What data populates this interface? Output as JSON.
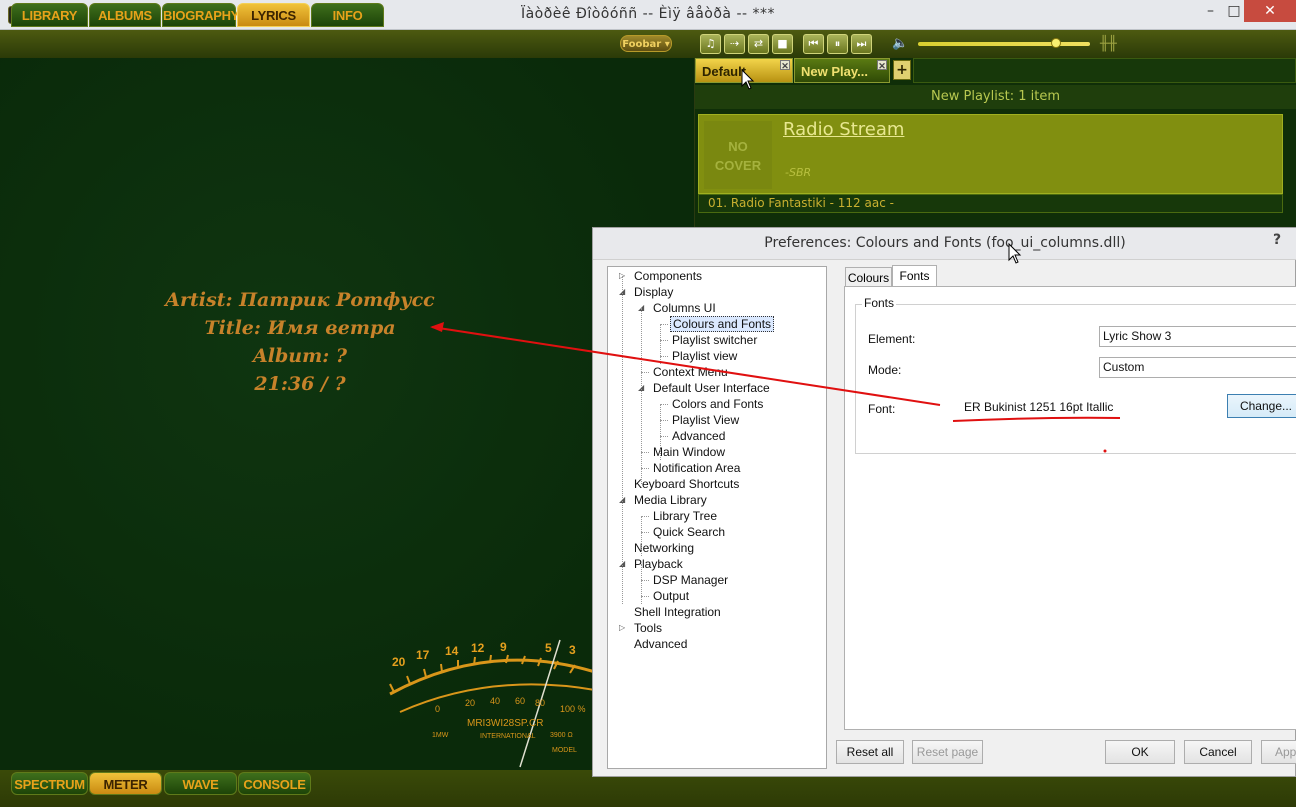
{
  "window": {
    "title": "Ïàòðèê Ðîòôóññ -- Èìÿ âåòðà --  ***",
    "minimize_glyph": "–",
    "maximize_glyph": "□",
    "close_glyph": "✕"
  },
  "top_tabs": [
    "LIBRARY",
    "ALBUMS",
    "BIOGRAPHY",
    "LYRICS",
    "INFO"
  ],
  "active_top_tab": "LYRICS",
  "foobar_menu": "Foobar ▾",
  "transport": {
    "buttons": [
      "♫",
      "⇢",
      "⇄",
      "■",
      "⏮",
      "⏸",
      "⏭"
    ],
    "volume_icon": "🔈",
    "eq_icon": "╫╫",
    "seek_fraction": 0.8
  },
  "lyrics": {
    "artist_line": "Artist: Патрик Ротфусс",
    "title_line": "Title: Имя ветра",
    "album_line": "Album: ?",
    "time_line": "21:36 / ?"
  },
  "meter": {
    "scale_labels": [
      "20",
      "17",
      "14",
      "12",
      "9",
      "5",
      "3"
    ],
    "inner_labels": [
      "0",
      "20",
      "40",
      "60",
      "80",
      "100 %"
    ],
    "model_text": "MRI3WI28SP.CR",
    "small_texts": [
      "1MW",
      "INTERNATIONAL",
      "3900 Ω",
      "MODEL"
    ]
  },
  "bottom_tabs": [
    "SPECTRUM",
    "METER",
    "WAVE",
    "CONSOLE"
  ],
  "active_bottom_tab": "METER",
  "playlist": {
    "tabs": [
      {
        "label": "Default",
        "close": "✕"
      },
      {
        "label": "New Play...",
        "close": "✕"
      }
    ],
    "add_tab": "+",
    "dropdown": "▼",
    "header": "New Playlist: 1 item",
    "cover_text": "NO COVER",
    "stream_title": "Radio Stream",
    "stream_sub": "-SBR",
    "track_line": "01.  Radio Fantastiki - 112 aac -"
  },
  "prefs": {
    "title": "Preferences: Colours and Fonts (foo_ui_columns.dll)",
    "help": "?",
    "tree": [
      {
        "label": "Components",
        "level": 0,
        "arrow": "▷"
      },
      {
        "label": "Display",
        "level": 0,
        "arrow": "◢"
      },
      {
        "label": "Columns UI",
        "level": 1,
        "arrow": "◢"
      },
      {
        "label": "Colours and Fonts",
        "level": 2,
        "selected": true
      },
      {
        "label": "Playlist switcher",
        "level": 2
      },
      {
        "label": "Playlist view",
        "level": 2
      },
      {
        "label": "Context Menu",
        "level": 1
      },
      {
        "label": "Default User Interface",
        "level": 1,
        "arrow": "◢"
      },
      {
        "label": "Colors and Fonts",
        "level": 2
      },
      {
        "label": "Playlist View",
        "level": 2
      },
      {
        "label": "Advanced",
        "level": 2
      },
      {
        "label": "Main Window",
        "level": 1
      },
      {
        "label": "Notification Area",
        "level": 1
      },
      {
        "label": "Keyboard Shortcuts",
        "level": 0
      },
      {
        "label": "Media Library",
        "level": 0,
        "arrow": "◢"
      },
      {
        "label": "Library Tree",
        "level": 1
      },
      {
        "label": "Quick Search",
        "level": 1
      },
      {
        "label": "Networking",
        "level": 0
      },
      {
        "label": "Playback",
        "level": 0,
        "arrow": "◢"
      },
      {
        "label": "DSP Manager",
        "level": 1
      },
      {
        "label": "Output",
        "level": 1
      },
      {
        "label": "Shell Integration",
        "level": 0
      },
      {
        "label": "Tools",
        "level": 0,
        "arrow": "▷"
      },
      {
        "label": "Advanced",
        "level": 0
      }
    ],
    "tabs": [
      "Colours",
      "Fonts"
    ],
    "active_tab": "Fonts",
    "group_label": "Fonts",
    "element_label": "Element:",
    "element_value": "Lyric Show 3",
    "mode_label": "Mode:",
    "mode_value": "Custom",
    "font_label": "Font:",
    "font_value": "ER Bukinist 1251 16pt Itallic",
    "change_button": "Change...",
    "reset_all": "Reset all",
    "reset_page": "Reset page",
    "ok": "OK",
    "cancel": "Cancel",
    "apply": "Apply"
  },
  "colors": {
    "accent_orange": "#c7822a",
    "annotation_red": "#e01010",
    "tab_active": "#f0c23a"
  }
}
